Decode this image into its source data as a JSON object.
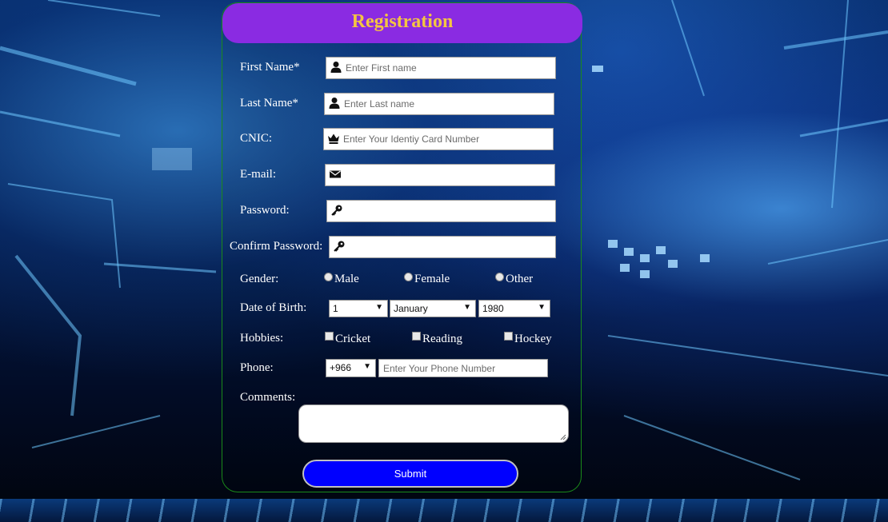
{
  "form": {
    "title": "Registration",
    "fields": {
      "first_name": {
        "label": "First Name*",
        "placeholder": "Enter First name",
        "icon": "user-icon"
      },
      "last_name": {
        "label": "Last Name*",
        "placeholder": "Enter Last name",
        "icon": "user-icon"
      },
      "cnic": {
        "label": "CNIC:",
        "placeholder": "Enter Your Identiy Card Number",
        "icon": "crown-icon"
      },
      "email": {
        "label": "E-mail:",
        "placeholder": "",
        "icon": "envelope-icon"
      },
      "password": {
        "label": "Password:",
        "placeholder": "",
        "icon": "key-icon"
      },
      "confirm_password": {
        "label": "Confirm Password:",
        "placeholder": "",
        "icon": "key-icon"
      }
    },
    "gender": {
      "label": "Gender:",
      "options": [
        "Male",
        "Female",
        "Other"
      ]
    },
    "dob": {
      "label": "Date of Birth:",
      "day": "1",
      "month": "January",
      "year": "1980"
    },
    "hobbies": {
      "label": "Hobbies:",
      "options": [
        "Cricket",
        "Reading",
        "Hockey"
      ]
    },
    "phone": {
      "label": "Phone:",
      "code": "+966",
      "placeholder": "Enter Your Phone Number"
    },
    "comments": {
      "label": "Comments:"
    },
    "submit_label": "Submit"
  },
  "colors": {
    "header_bg": "#8a2be2",
    "title_color": "#f4c542",
    "submit_bg": "#0000ff",
    "card_border": "#1a8a1a"
  }
}
